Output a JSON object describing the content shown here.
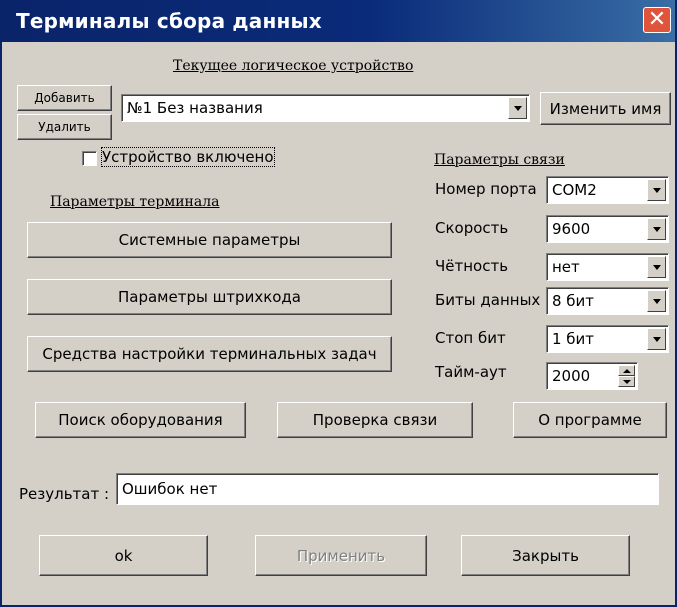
{
  "window": {
    "title": "Терминалы сбора данных",
    "close_symbol": "✕"
  },
  "device": {
    "section_title": "Текущее логическое устройство",
    "add_label": "Добавить",
    "delete_label": "Удалить",
    "selected": "№1 Без названия",
    "rename_label": "Изменить имя",
    "enabled_label": "Устройство включено",
    "enabled": false
  },
  "terminal": {
    "section_title": "Параметры терминала",
    "system_params_label": "Системные параметры",
    "barcode_params_label": "Параметры штрихкода",
    "task_tools_label": "Средства настройки терминальных задач"
  },
  "connection": {
    "section_title": "Параметры связи",
    "port_label": "Номер порта",
    "port_value": "COM2",
    "speed_label": "Скорость",
    "speed_value": "9600",
    "parity_label": "Чётность",
    "parity_value": "нет",
    "data_bits_label": "Биты данных",
    "data_bits_value": "8 бит",
    "stop_bits_label": "Стоп бит",
    "stop_bits_value": "1 бит",
    "timeout_label": "Тайм-аут",
    "timeout_value": "2000"
  },
  "actions": {
    "search_label": "Поиск оборудования",
    "check_label": "Проверка связи",
    "about_label": "О программе"
  },
  "result": {
    "label": "Результат :",
    "value": "Ошибок нет"
  },
  "footer": {
    "ok_label": "ok",
    "apply_label": "Применить",
    "close_label": "Закрыть"
  },
  "colors": {
    "titlebar": "#0a246a",
    "face": "#d4d0c8",
    "close_button": "#e0543b"
  }
}
